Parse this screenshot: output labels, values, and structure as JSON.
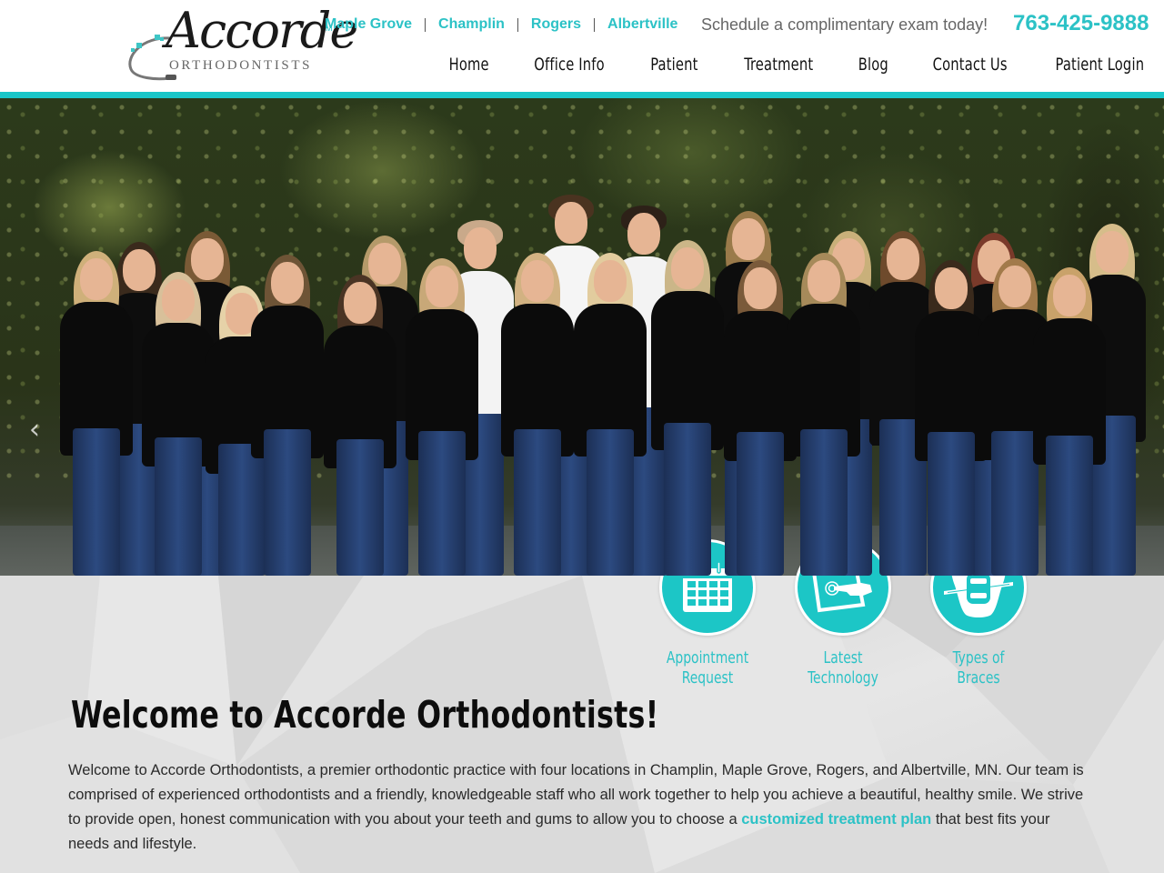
{
  "brand": {
    "logo_script": "Accorde",
    "logo_subtitle": "ORTHODONTISTS",
    "logo_mark": "M",
    "accent_color": "#2cc2c6",
    "bar_color": "#19c6c8"
  },
  "header": {
    "locations": [
      "Maple Grove",
      "Champlin",
      "Rogers",
      "Albertville"
    ],
    "schedule_text": "Schedule a complimentary exam today!",
    "phone": "763-425-9888"
  },
  "nav": {
    "items": [
      "Home",
      "Office Info",
      "Patient",
      "Treatment",
      "Blog",
      "Contact Us",
      "Patient Login"
    ]
  },
  "hero": {
    "alt": "Accorde Orthodontists team photo",
    "prev_icon": "chevron-left-icon",
    "prev_glyph": "‹"
  },
  "quick_links": [
    {
      "icon": "calendar-icon",
      "line1": "Appointment",
      "line2": "Request"
    },
    {
      "icon": "touchscreen-icon",
      "line1": "Latest",
      "line2": "Technology"
    },
    {
      "icon": "braces-tooth-icon",
      "line1": "Types of",
      "line2": "Braces"
    }
  ],
  "welcome": {
    "title": "Welcome to Accorde Orthodontists!",
    "text_before": "Welcome to Accorde Orthodontists, a premier orthodontic practice with four locations in Champlin, Maple Grove, Rogers, and Albertville, MN. Our team is comprised of experienced orthodontists and a friendly, knowledgeable staff who all work together to help you achieve a beautiful, healthy smile. We strive to provide open, honest communication with you about your teeth and gums to allow you to choose a ",
    "link_text": "customized treatment plan",
    "text_after": " that best fits your needs and lifestyle."
  }
}
